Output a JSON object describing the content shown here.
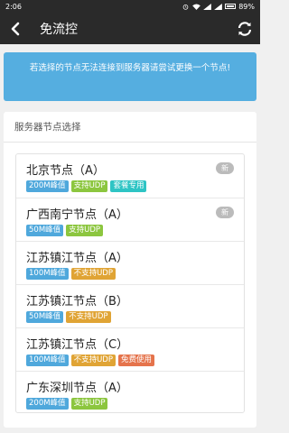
{
  "status_bar": {
    "time": "2:06",
    "battery": "89%"
  },
  "header": {
    "title": "免流控"
  },
  "notice": {
    "text": "若选择的节点无法连接到服务器请尝试更换一个节点!"
  },
  "section": {
    "title": "服务器节点选择"
  },
  "colors": {
    "blue": "#4fa8dc",
    "green": "#8cc63f",
    "teal": "#2ec4c4",
    "orange": "#e0a435",
    "red": "#e5734b",
    "notice": "#55aee0",
    "bar": "#2a2a2a"
  },
  "nodes": [
    {
      "name": "北京节点（A）",
      "new": "新",
      "tags": [
        {
          "text": "200M峰值",
          "color": "blue"
        },
        {
          "text": "支持UDP",
          "color": "green"
        },
        {
          "text": "套餐专用",
          "color": "teal"
        }
      ]
    },
    {
      "name": "广西南宁节点（A）",
      "new": "新",
      "tags": [
        {
          "text": "50M峰值",
          "color": "blue"
        },
        {
          "text": "支持UDP",
          "color": "green"
        }
      ]
    },
    {
      "name": "江苏镇江节点（A）",
      "new": "",
      "tags": [
        {
          "text": "100M峰值",
          "color": "blue"
        },
        {
          "text": "不支持UDP",
          "color": "orange"
        }
      ]
    },
    {
      "name": "江苏镇江节点（B）",
      "new": "",
      "tags": [
        {
          "text": "50M峰值",
          "color": "blue"
        },
        {
          "text": "不支持UDP",
          "color": "orange"
        }
      ]
    },
    {
      "name": "江苏镇江节点（C）",
      "new": "",
      "tags": [
        {
          "text": "100M峰值",
          "color": "blue"
        },
        {
          "text": "不支持UDP",
          "color": "orange"
        },
        {
          "text": "免费使用",
          "color": "red"
        }
      ]
    },
    {
      "name": "广东深圳节点（A）",
      "new": "",
      "tags": [
        {
          "text": "200M峰值",
          "color": "blue"
        },
        {
          "text": "支持UDP",
          "color": "green"
        }
      ]
    }
  ]
}
